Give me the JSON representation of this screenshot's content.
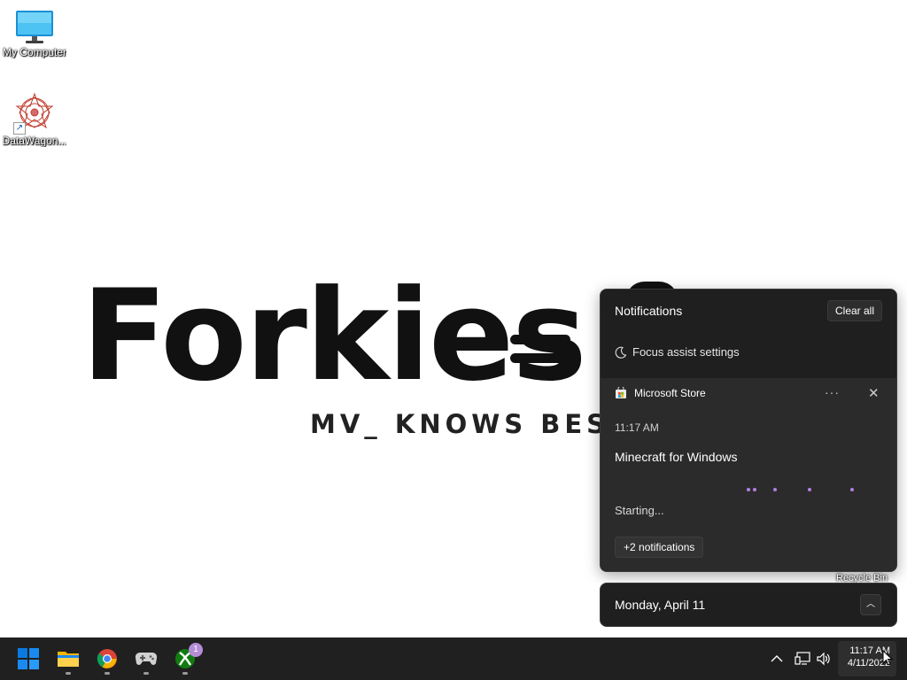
{
  "desktop": {
    "icons": [
      {
        "label": "My Computer",
        "icon": "monitor-icon"
      },
      {
        "label": "DataWagon...",
        "icon": "datawagon-icon"
      }
    ],
    "recycle_bin_label": "Recycle Bin"
  },
  "wallpaper": {
    "title": "Forkies",
    "subtitle": "MV_ KNOWS BEST"
  },
  "notifications": {
    "title": "Notifications",
    "clear_all": "Clear all",
    "focus_assist": "Focus assist settings",
    "card": {
      "app": "Microsoft Store",
      "time": "11:17 AM",
      "heading": "Minecraft for Windows",
      "status": "Starting...",
      "more_label": "···"
    },
    "more_notifications": "+2 notifications"
  },
  "calendar": {
    "date": "Monday, April 11"
  },
  "taskbar": {
    "apps": [
      "start-icon",
      "file-explorer-icon",
      "chrome-icon",
      "gamepad-icon",
      "xbox-icon"
    ],
    "xbox_badge": "1",
    "clock_time": "11:17 AM",
    "clock_date": "4/11/2022"
  },
  "colors": {
    "panel_bg": "#1f1f1f",
    "card_bg": "#2b2b2b",
    "taskbar_bg": "#202020",
    "accent_purple": "#b37fe0",
    "windows_blue": "#0a7ae0"
  }
}
